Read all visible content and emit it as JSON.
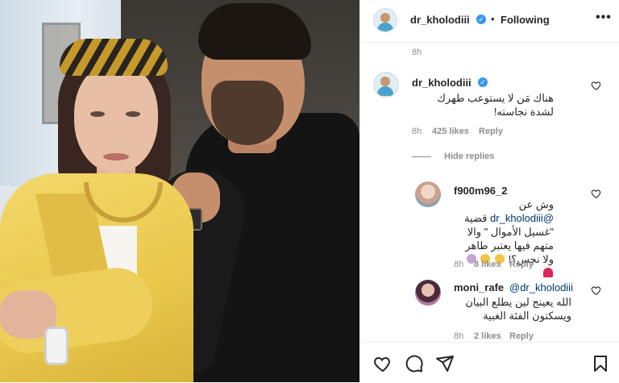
{
  "post": {
    "username": "dr_kholodiii",
    "separator": "•",
    "follow_status": "Following",
    "more_label": "•••"
  },
  "caption": {
    "time": "8h"
  },
  "comments": [
    {
      "username": "dr_kholodiii",
      "text": "هناك مَن لا يستوعب طهرك لشدة نجاسته!",
      "time": "8h",
      "likes": "425 likes",
      "reply": "Reply",
      "verified": true
    }
  ],
  "hide_replies_label": "Hide replies",
  "replies": [
    {
      "username": "f900m96_2",
      "mention": "@dr_kholodiii",
      "text_line1": "وش عن",
      "text_rest": "قضية \"غسيل الأموال \" والا متهم فيها يعتبر طاهر ولا نجس؟!",
      "time": "8h",
      "likes": "8 likes",
      "reply": "Reply"
    },
    {
      "username": "moni_rafe",
      "mention": "@dr_kholodiii",
      "text": "الله يعينج لين يطلع البيان ويسكتون الفئة الغبية",
      "time": "8h",
      "likes": "2 likes",
      "reply": "Reply"
    }
  ],
  "icons": {
    "like": "heart-icon",
    "comment": "comment-icon",
    "share": "share-icon",
    "save": "bookmark-icon",
    "verified": "verified-badge-icon"
  },
  "colors": {
    "verified_blue": "#3897f0",
    "mention_blue": "#00376b",
    "muted_text": "#8e8e8e",
    "emoji_heart": "#e0245e"
  }
}
